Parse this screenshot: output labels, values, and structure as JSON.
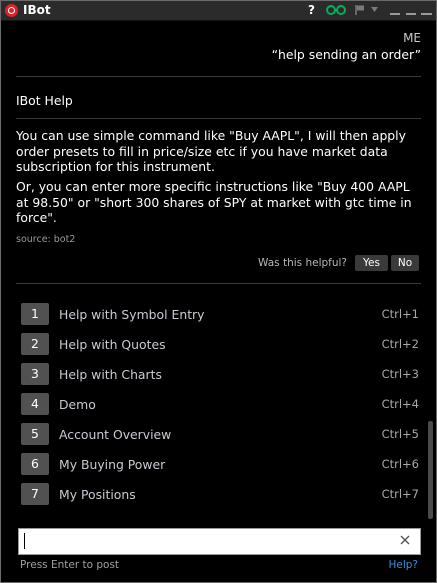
{
  "window": {
    "title": "IBot",
    "help_label": "?",
    "accent_color": "#00b05a",
    "brand_color": "#d8232a"
  },
  "conversation": {
    "me_label": "ME",
    "me_message": "“help sending an order”",
    "bot_title": "IBot Help",
    "paragraph1": "You can use simple command like \"Buy AAPL\", I will then apply order presets to fill in price/size etc if you have market data subscription for this instrument.",
    "paragraph2": "Or, you can enter more specific instructions like \"Buy 400 AAPL at 98.50\" or \"short 300 shares of SPY at market with gtc time in force\".",
    "source": "source: bot2",
    "feedback": {
      "question": "Was this helpful?",
      "yes": "Yes",
      "no": "No"
    }
  },
  "menu": {
    "items": [
      {
        "number": "1",
        "label": "Help with Symbol Entry",
        "shortcut": "Ctrl+1"
      },
      {
        "number": "2",
        "label": "Help with Quotes",
        "shortcut": "Ctrl+2"
      },
      {
        "number": "3",
        "label": "Help with Charts",
        "shortcut": "Ctrl+3"
      },
      {
        "number": "4",
        "label": "Demo",
        "shortcut": "Ctrl+4"
      },
      {
        "number": "5",
        "label": "Account Overview",
        "shortcut": "Ctrl+5"
      },
      {
        "number": "6",
        "label": "My Buying Power",
        "shortcut": "Ctrl+6"
      },
      {
        "number": "7",
        "label": "My Positions",
        "shortcut": "Ctrl+7"
      }
    ]
  },
  "input": {
    "value": "",
    "placeholder": "",
    "hint": "Press Enter to post",
    "help_link": "Help?"
  }
}
